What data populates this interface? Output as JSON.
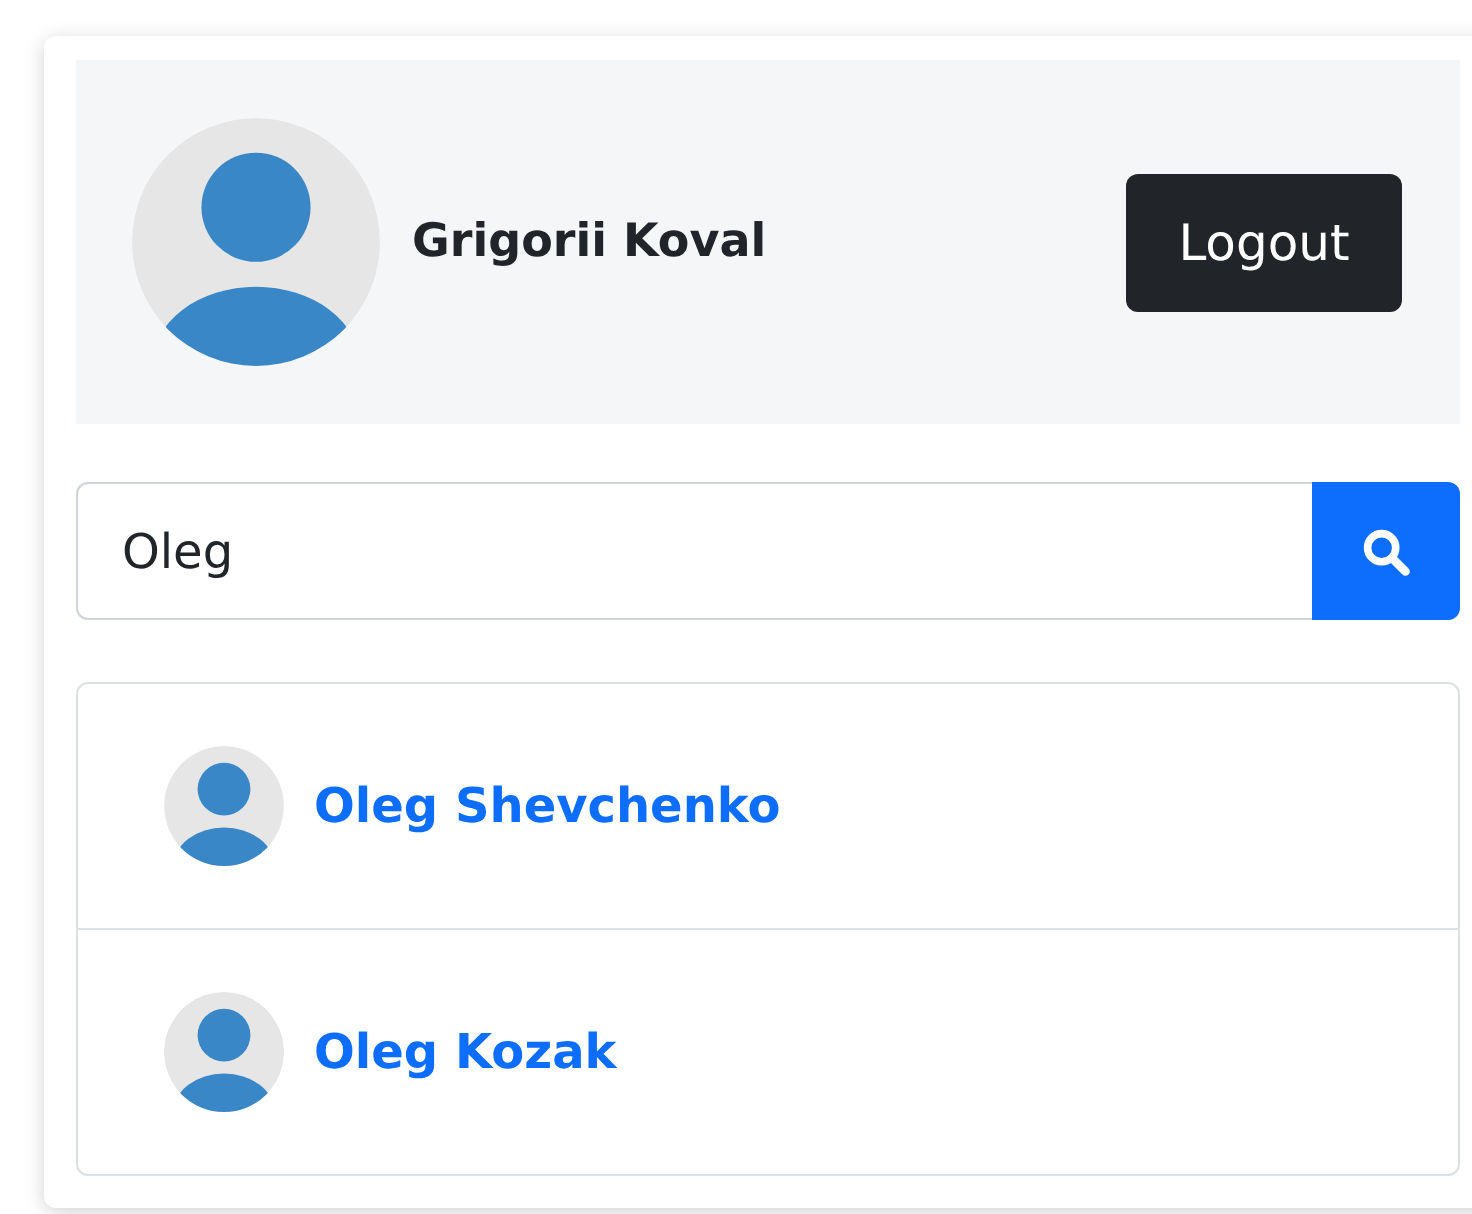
{
  "profile": {
    "name": "Grigorii Koval",
    "logout_label": "Logout"
  },
  "search": {
    "value": "Oleg"
  },
  "results": [
    {
      "name": "Oleg Shevchenko"
    },
    {
      "name": "Oleg Kozak"
    }
  ]
}
